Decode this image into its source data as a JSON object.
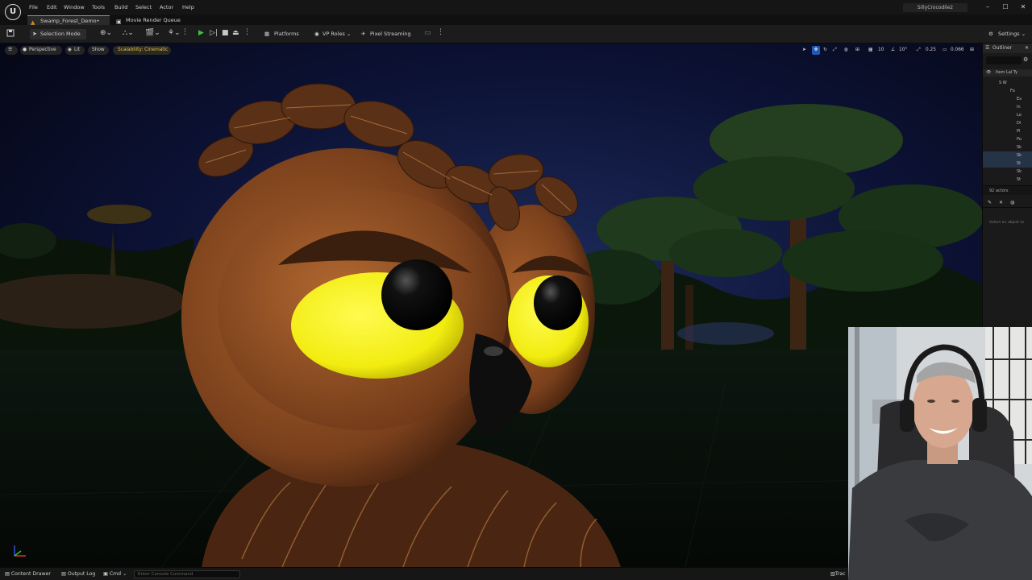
{
  "window": {
    "menus": [
      "File",
      "Edit",
      "Window",
      "Tools",
      "Build",
      "Select",
      "Actor",
      "Help"
    ],
    "user": "SillyCrocodile2",
    "controls": {
      "minimize": "–",
      "maximize": "☐",
      "close": "✕"
    }
  },
  "tabs": [
    {
      "label": "Swamp_Forest_Demo•",
      "icon": "level-icon"
    },
    {
      "label": "Movie Render Queue",
      "icon": "film-icon"
    }
  ],
  "toolbar": {
    "selection_mode": "Selection Mode",
    "platforms": "Platforms",
    "vp_roles": "VP Roles",
    "pixel_streaming": "Pixel Streaming",
    "settings": "Settings"
  },
  "viewport": {
    "perspective": "Perspective",
    "lit": "Lit",
    "show": "Show",
    "scalability": "Scalability: Cinematic",
    "grid_size": "10",
    "rotation_snap": "10°",
    "scale_snap": "0.25",
    "camera_speed": "0.066"
  },
  "outliner": {
    "title": "Outliner",
    "column_header": "Item Lal Ty",
    "rows": [
      "S W",
      "Fo",
      "Ex",
      "In",
      "Lo",
      "Di",
      "Pl",
      "Po",
      "Sk",
      "Sk",
      "St",
      "Sk",
      "St"
    ],
    "actor_count": "92 actors",
    "details_hint": "Select an object to"
  },
  "statusbar": {
    "content_drawer": "Content Drawer",
    "output_log": "Output Log",
    "cmd": "Cmd",
    "console_placeholder": "Enter Console Command",
    "trace": "Trac"
  },
  "colors": {
    "accent_orange": "#d08a20",
    "play_green": "#3fbf3f",
    "selected_blue": "#1f5ab8",
    "owl_eye_yellow": "#f2ec10",
    "owl_body_brown": "#8a4a22"
  }
}
